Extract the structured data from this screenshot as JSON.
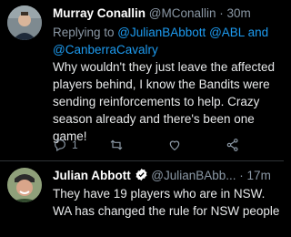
{
  "tweets": [
    {
      "author_name": "Murray Conallin",
      "handle": "@MConallin",
      "time": "30m",
      "reply_prefix": "Replying to ",
      "reply_mentions": [
        "@JulianBAbbott",
        "@ABL",
        "@CanberraCavalry"
      ],
      "reply_and": " and ",
      "text": "Why wouldn't they just leave the affected players behind, I know the Bandits were sending reinforcements to help. Crazy season already and there's been one game!",
      "reply_count": "1"
    },
    {
      "author_name": "Julian Abbott",
      "handle": "@JulianBAbb...",
      "time": "17m",
      "text": "They have 19 players who are in NSW. WA has changed the rule for NSW people"
    }
  ],
  "icons": {
    "reply": "reply-icon",
    "retweet": "retweet-icon",
    "like": "like-icon",
    "share": "share-icon",
    "verified": "verified-badge-icon"
  },
  "colors": {
    "background": "#000000",
    "text": "#e7e9ea",
    "secondary": "#8b98a5",
    "link": "#1d9bf0"
  }
}
